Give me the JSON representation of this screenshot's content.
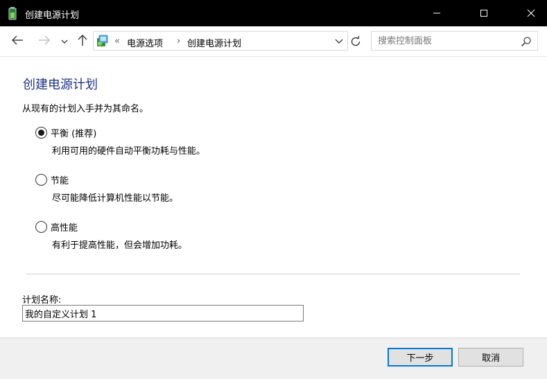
{
  "window": {
    "title": "创建电源计划"
  },
  "icons": {
    "app": "power-battery-icon",
    "minimize": "minimize-icon",
    "maximize": "maximize-icon",
    "close": "close-icon",
    "back": "back-arrow-icon",
    "forward": "forward-arrow-icon",
    "recent": "chevron-down-icon",
    "up": "up-arrow-icon",
    "control_panel": "control-panel-icon",
    "refresh": "refresh-icon",
    "search": "search-icon"
  },
  "breadcrumb": {
    "chevron": "«",
    "items": [
      "电源选项",
      "创建电源计划"
    ],
    "separator": "›"
  },
  "search": {
    "placeholder": "搜索控制面板",
    "value": ""
  },
  "main": {
    "title": "创建电源计划",
    "subtitle": "从现有的计划入手并为其命名。",
    "options": [
      {
        "label": "平衡 (推荐)",
        "description": "利用可用的硬件自动平衡功耗与性能。",
        "selected": true
      },
      {
        "label": "节能",
        "description": "尽可能降低计算机性能以节能。",
        "selected": false
      },
      {
        "label": "高性能",
        "description": "有利于提高性能，但会增加功耗。",
        "selected": false
      }
    ],
    "plan_name_label": "计划名称:",
    "plan_name_value": "我的自定义计划 1"
  },
  "footer": {
    "next": "下一步",
    "cancel": "取消"
  },
  "colors": {
    "titlebar": "#000000",
    "title_text": "#1e3287",
    "accent": "#0078d7"
  }
}
